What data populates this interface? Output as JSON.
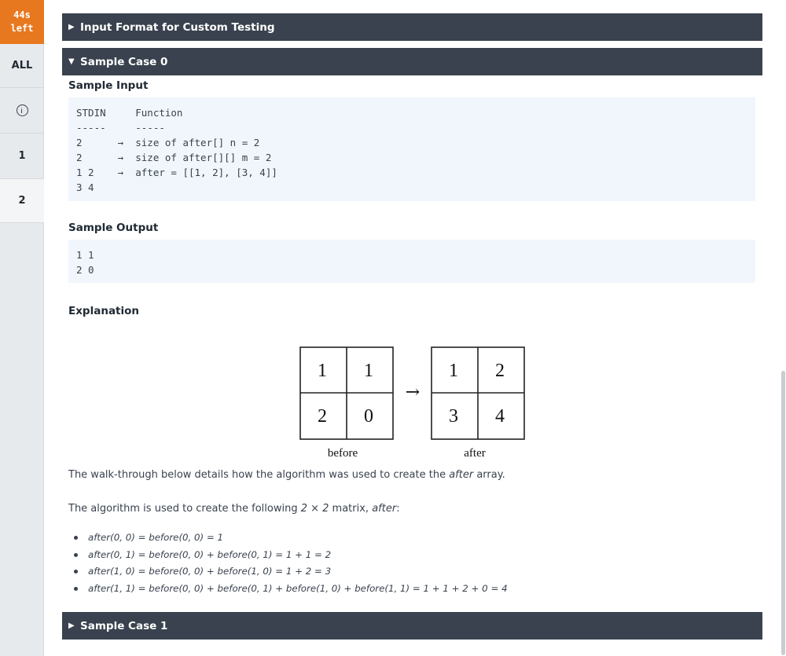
{
  "sidebar": {
    "timer_line1": "44s",
    "timer_line2": "left",
    "all_label": "ALL",
    "info_icon": "info-icon",
    "question_1": "1",
    "question_2": "2"
  },
  "sections": {
    "input_format_bar": "Input Format for Custom Testing",
    "sample_case_0_bar": "Sample Case 0",
    "sample_case_1_bar": "Sample Case 1",
    "collapsed_icon": "triangle-right",
    "expanded_icon": "triangle-down"
  },
  "sample_case_0": {
    "sample_input_label": "Sample Input",
    "sample_input": "STDIN     Function\n-----     -----\n2      →  size of after[] n = 2\n2      →  size of after[][] m = 2\n1 2    →  after = [[1, 2], [3, 4]]\n3 4",
    "sample_output_label": "Sample Output",
    "sample_output": "1 1\n2 0",
    "explanation_label": "Explanation",
    "diagram": {
      "before": [
        "1",
        "1",
        "2",
        "0"
      ],
      "after": [
        "1",
        "2",
        "3",
        "4"
      ],
      "arrow": "→",
      "before_caption": "before",
      "after_caption": "after"
    },
    "walkthrough_pre": "The walk-through below details how the algorithm was used to create the ",
    "walkthrough_em": "after",
    "walkthrough_post": " array.",
    "algorithm_pre": "The algorithm is used to create the following ",
    "algorithm_em1": "2 × 2",
    "algorithm_mid": " matrix, ",
    "algorithm_em2": "after",
    "algorithm_post": ":",
    "bullets": [
      "after(0, 0) = before(0, 0) = 1",
      "after(0, 1) = before(0, 0) + before(0, 1) = 1 + 1 = 2",
      "after(1, 0) = before(0, 0) + before(1, 0) = 1 + 2 = 3",
      "after(1, 1) = before(0, 0) + before(0, 1) + before(1, 0) + before(1, 1) = 1 + 1 + 2 + 0 = 4"
    ]
  }
}
